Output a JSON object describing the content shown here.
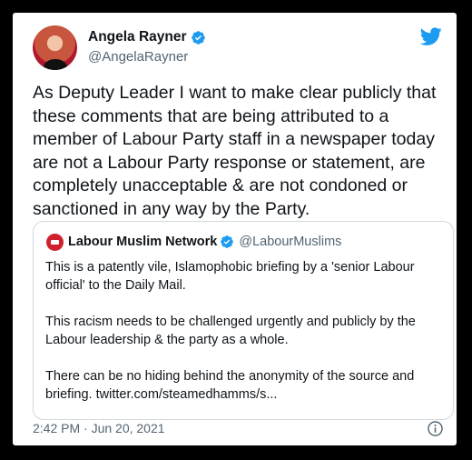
{
  "tweet": {
    "author_name": "Angela Rayner",
    "author_handle": "@AngelaRayner",
    "text": "As Deputy Leader I want to make clear publicly that these comments that are being attributed to a member of Labour Party staff in a newspaper today are not a Labour Party response or statement, are completely unacceptable & are not condoned or sanctioned in any way by the Party.",
    "timestamp": "2:42 PM · Jun 20, 2021",
    "verified_icon": "verified-badge-icon",
    "platform_icon": "twitter-bird-icon",
    "info_icon": "info-icon"
  },
  "quoted_tweet": {
    "author_name": "Labour Muslim Network",
    "author_handle": "@LabourMuslims",
    "text": "This is a patently vile, Islamophobic briefing by a 'senior Labour official' to the Daily Mail.\n\nThis racism needs to be challenged urgently and publicly by the Labour leadership & the party as a whole.\n\nThere can be no hiding behind the anonymity of the source and briefing. twitter.com/steamedhamms/s..."
  },
  "colors": {
    "twitter_blue": "#1d9bf0",
    "text_primary": "#0f1419",
    "text_secondary": "#536471",
    "border": "#cfd9de",
    "labour_red": "#d0202e"
  }
}
